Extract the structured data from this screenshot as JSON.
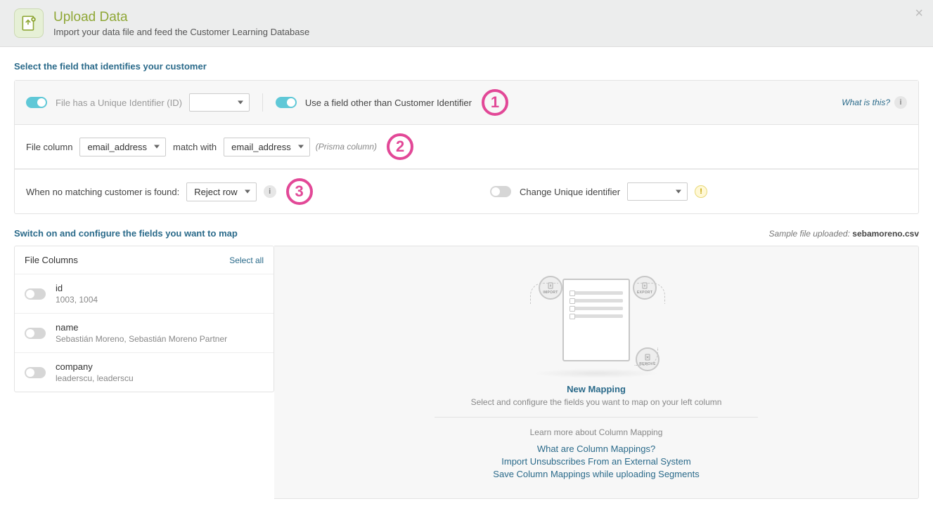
{
  "header": {
    "title": "Upload Data",
    "subtitle": "Import your data file and feed the Customer Learning Database"
  },
  "section1": {
    "title": "Select the field that identifies your customer",
    "unique_id_label": "File has a Unique Identifier (ID)",
    "other_field_label": "Use a field other than Customer Identifier",
    "what_is_this": "What is this?",
    "file_column_label": "File column",
    "file_column_value": "email_address",
    "match_with_label": "match with",
    "match_with_value": "email_address",
    "prisma_hint": "(Prisma column)",
    "no_match_label": "When no matching customer is found:",
    "no_match_value": "Reject row",
    "change_uid_label": "Change Unique identifier"
  },
  "callouts": {
    "c1": "1",
    "c2": "2",
    "c3": "3"
  },
  "section2": {
    "title": "Switch on and configure the fields you want to map",
    "sample_prefix": "Sample file uploaded: ",
    "sample_file": "sebamoreno.csv",
    "file_columns_header": "File Columns",
    "select_all": "Select all",
    "fields": [
      {
        "name": "id",
        "sample": "1003, 1004"
      },
      {
        "name": "name",
        "sample": "Sebastián Moreno, Sebastián Moreno Partner"
      },
      {
        "name": "company",
        "sample": "leaderscu, leaderscu"
      }
    ],
    "new_mapping": "New Mapping",
    "new_mapping_sub": "Select and configure the fields you want to map on your left column",
    "learn_more": "Learn more about Column Mapping",
    "links": [
      "What are Column Mappings?",
      "Import Unsubscribes From an External System",
      "Save Column Mappings while uploading Segments"
    ],
    "badges": {
      "import": "IMPORT",
      "export": "EXPORT",
      "remove": "REMOVE"
    }
  }
}
